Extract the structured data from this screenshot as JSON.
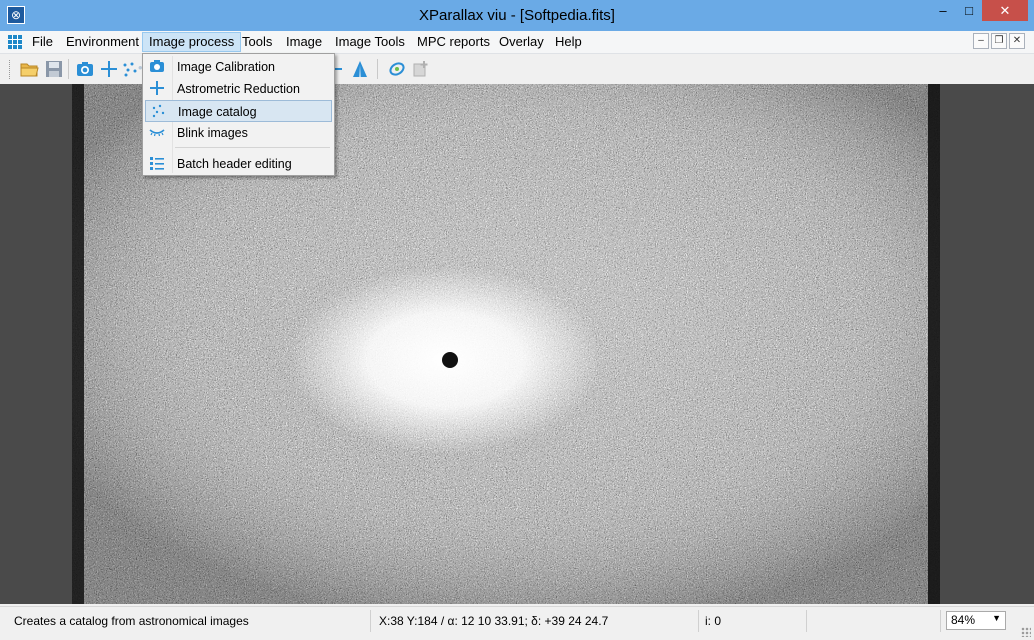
{
  "window": {
    "title": "XParallax viu - [Softpedia.fits]",
    "controls": {
      "minimize": "–",
      "maximize": "□",
      "close": "✕"
    }
  },
  "menubar": {
    "items": [
      {
        "label": "File"
      },
      {
        "label": "Environment"
      },
      {
        "label": "Image process",
        "active": true
      },
      {
        "label": "Tools"
      },
      {
        "label": "Image"
      },
      {
        "label": "Image Tools"
      },
      {
        "label": "MPC reports"
      },
      {
        "label": "Overlay"
      },
      {
        "label": "Help"
      }
    ],
    "mdi_controls": {
      "minimize": "–",
      "restore": "❐",
      "close": "✕"
    }
  },
  "toolbar": {
    "icons": [
      "open-folder-icon",
      "save-disk-icon",
      "camera-icon",
      "crosshair-icon",
      "dots-icon",
      "plus-icon",
      "triangle-icon",
      "target-icon",
      "copy-plus-icon"
    ]
  },
  "dropdown": {
    "items": [
      {
        "label": "Image Calibration",
        "icon": "camera-icon"
      },
      {
        "label": "Astrometric Reduction",
        "icon": "crosshair-icon"
      },
      {
        "label": "Image catalog",
        "icon": "scatter-dots-icon",
        "highlighted": true
      },
      {
        "label": "Blink images",
        "icon": "blink-eye-icon"
      },
      {
        "label": "Batch header editing",
        "icon": "list-icon"
      }
    ]
  },
  "statusbar": {
    "message": "Creates a catalog from astronomical images",
    "coords": "X:38 Y:184 / α:  12 10 33.91; δ: +39 24 24.7",
    "intensity": "i: 0",
    "zoom": "84%"
  },
  "colors": {
    "titlebar": "#6aaae6",
    "close_button": "#c7504a",
    "menu_active": "#cce4f7",
    "icon_accent": "#2b8fd6"
  }
}
